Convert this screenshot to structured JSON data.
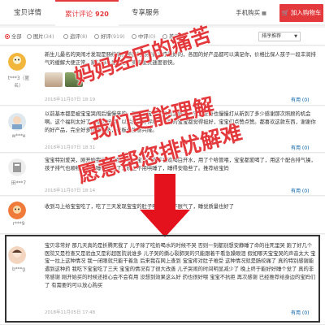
{
  "tabs": {
    "detail": "宝贝详情",
    "reviews": "累计评论",
    "reviews_count": "920",
    "service": "专享服务",
    "mobile": "手机购买",
    "mobile_icon": "qrcode-icon",
    "cart": "加入购物车"
  },
  "filters": {
    "all": "全部",
    "photos": "图片",
    "photos_count": "(34)",
    "followup": "追评",
    "followup_count": "(8)",
    "good": "好评",
    "good_count": "(919)",
    "neutral": "中评",
    "neutral_count": "(0)",
    "bad": "差评",
    "bad_count": "(1)",
    "sort": "排序推荐"
  },
  "reviews": [
    {
      "user": "t***3（匿名）",
      "stars": "★★★★★",
      "text": "新生儿最名的哭闹才发现是肠绞痛。美国的肠绞痛治疗最好的，各国的好产品都可以满足你，价格比保人孩子一段丰润排气的缓解大便正常。家父母心里放心。卖家发货速度很快。",
      "date": "2018年11月07日 18:19",
      "useful": "有用 (0)"
    },
    {
      "user": "w***e",
      "stars": "★★★★★",
      "text": "以前基本都是被宝宝哭闹后慢慢来的，现在宝宝一个月出生好后，宝宝全身也慢慢打从新到了多少感谢那次照顾的机会啊。这个福利太好了，宝贝好用，以后应只好评和一个别的宝宝都觉得挺好，宝宝们点赞点赞。都喜欢这款东西，谢谢你的好产品，完全好多优惠多多，老板也生意兴隆。",
      "date": "2018年11月07日 18:31",
      "useful": "有用 (0)"
    },
    {
      "user": "田***7",
      "stars": "★★★★★",
      "text": "宝宝特别爱哭，刚开始我们以为肚子饿，宝贝一直不喜欢喝白开水，用了个哈管喂，宝宝都爱喝了，用这个配合排气操，孩子排气也顺畅，宝宝睡得香甜了，晚上不用哄睡了，睡得安稳些了。推荐给宝妈",
      "date": "2018年11月07日 18:14",
      "useful": "有用 (0)"
    },
    {
      "user": "r***9",
      "stars": "★★★★★",
      "text": "收到马上给宝宝吃了，吃了三天发现宝宝的肚子明显软了不胀气了，睡觉质量也好了",
      "date": "",
      "useful": ""
    },
    {
      "user": "b***g",
      "stars": "★★★★★",
      "text": "宝贝非常好 那几天真的是折腾死我了 儿子除了吃奶喝水的时候不哭 否则一刻都别想安静睡了命的往死里哭 跑了好几个医院又是检查又是验血又是彩超医院说谁多 儿子哭的撕心裂肺哭的只能跟着干看急躁眼泪 假如哪天宝宝哭的声音太大 宝宝一拉上这种情况 我一闭眼就只能干着急 后来我在网上查到 宝宝疼对肚子难受 这种情况就是肠绞痛了 真的特别感谢能遇到这种药 我吃下宝宝吃了三天 宝宝的情况有了很大改善 儿子哭闹的时间明显减少了 晚上终于能好好睡个觉了 真的非常感谢 刚开始买的时候还担心会不会有用 没想到效果这么好 药也很好喂 宝宝不抗拒 再次感谢 已经推荐给身边的宝妈们了 有需要的可以放心购买",
      "date": "2018年11月05日 17:48",
      "useful": "有用 (0)"
    }
  ],
  "overlays": {
    "line1": "妈妈经历的痛苦",
    "line2": "我们更能理解",
    "line3": "愿意帮您排忧解难"
  },
  "colors": {
    "accent": "#e4393c",
    "star": "#f5a623",
    "link": "#005ea7"
  }
}
